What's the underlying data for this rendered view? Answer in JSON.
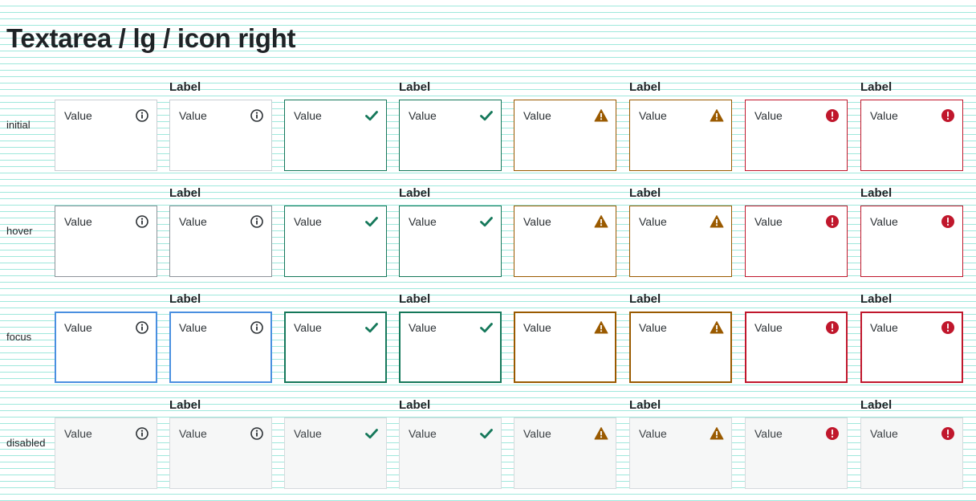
{
  "title": "Textarea / lg / icon right",
  "rows": [
    "initial",
    "hover",
    "focus",
    "disabled"
  ],
  "label_text": "Label",
  "value_text": "Value",
  "icons": {
    "neutral": "info-icon",
    "success": "checkmark-icon",
    "warning": "warning-icon",
    "error": "error-icon"
  },
  "colors": {
    "neutral_border": "#c9ced3",
    "neutral_hover_border": "#8d949a",
    "focus_border": "#4a8fe0",
    "success": "#15785a",
    "warning": "#9a5a00",
    "error": "#c0172c",
    "disabled_bg": "#f6f7f7",
    "disabled_border": "#d6dadd"
  }
}
